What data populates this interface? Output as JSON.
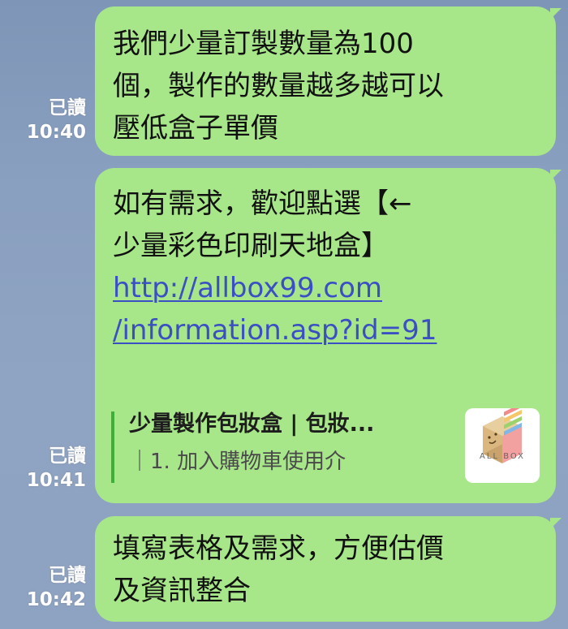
{
  "messages": [
    {
      "read_label": "已讀",
      "time": "10:40",
      "text": "我們少量訂製數量為100\n個，製作的數量越多越可以\n壓低盒子單價"
    },
    {
      "read_label": "已讀",
      "time": "10:41",
      "text": "如有需求，歡迎點選【←\n少量彩色印刷天地盒】",
      "link_line1": "http://allbox99.com",
      "link_line2": "/information.asp?id=91",
      "preview": {
        "title": "少量製作包妝盒 | 包妝...",
        "desc": "｜1. 加入購物車使用介",
        "thumb_caption": "ALL BOX"
      }
    },
    {
      "read_label": "已讀",
      "time": "10:42",
      "text": "填寫表格及需求，方便估價\n及資訊整合"
    }
  ],
  "colors": {
    "bubble": "#a8e68a",
    "link": "#3a4fc4",
    "preview_bar": "#3fae3a"
  }
}
